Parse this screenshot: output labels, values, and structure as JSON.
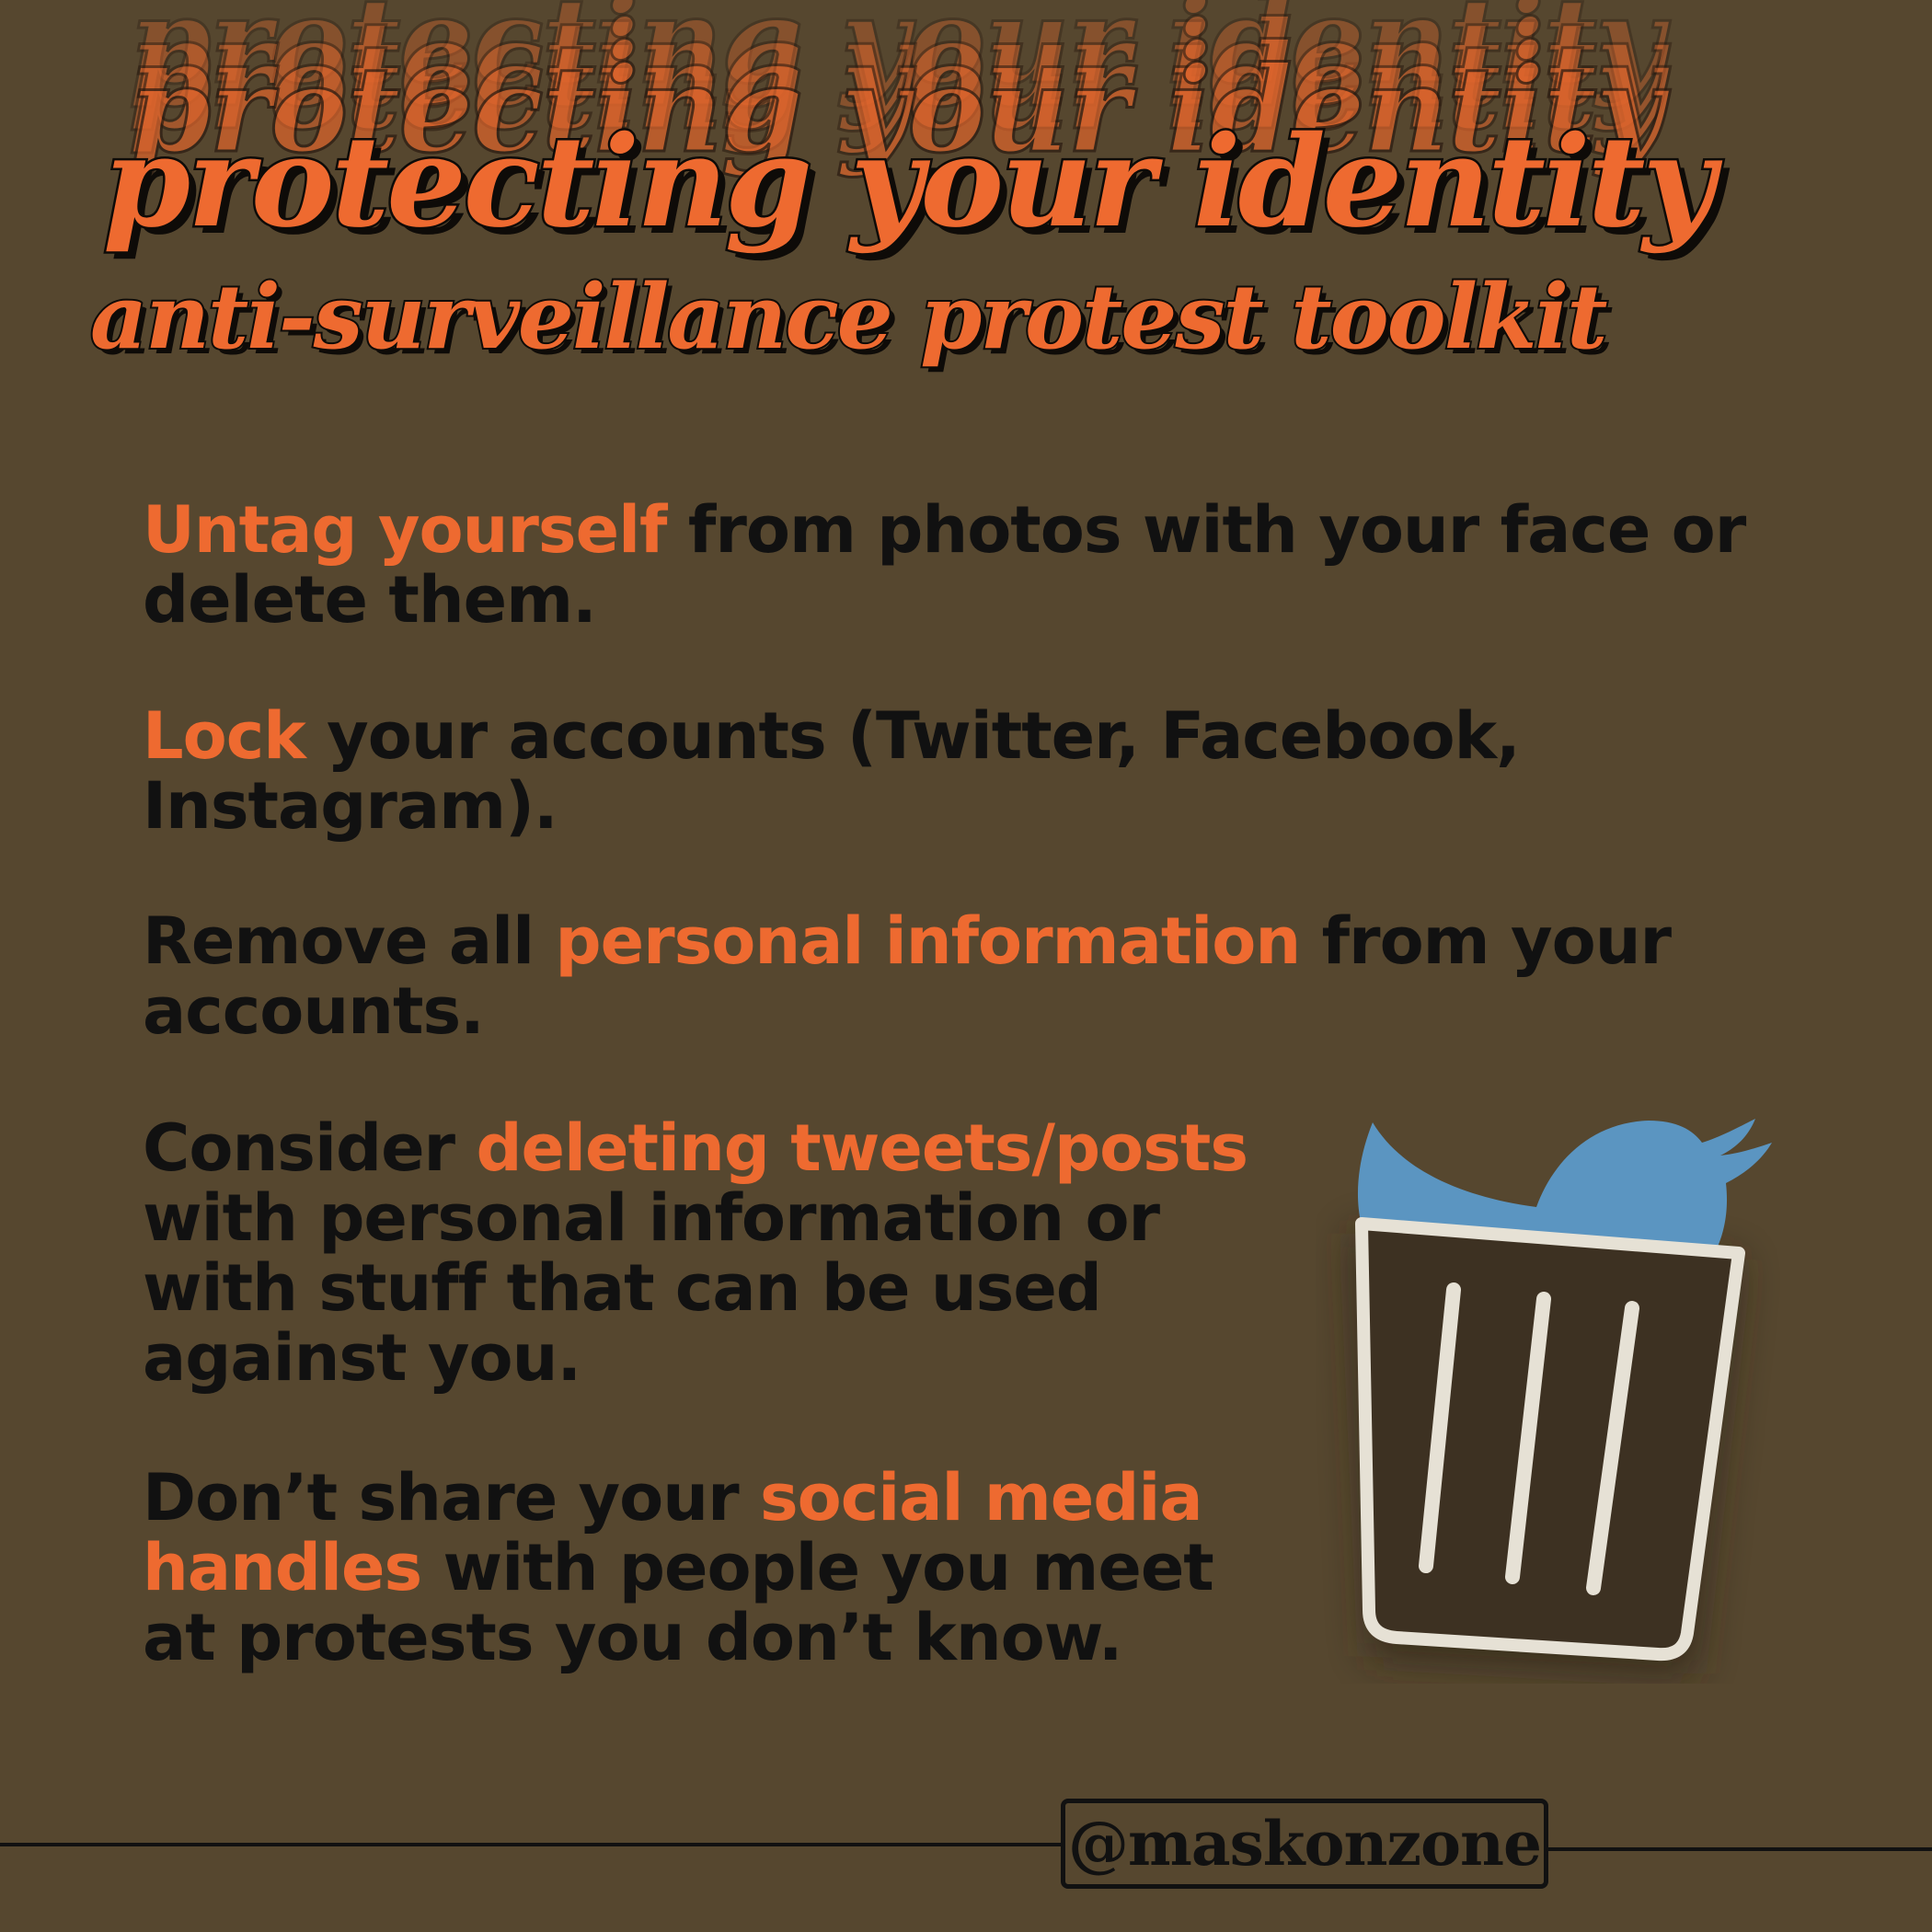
{
  "header": {
    "title": "protecting your identity",
    "subtitle": "anti-surveillance protest toolkit"
  },
  "tips": [
    {
      "pre": "",
      "highlight": "Untag yourself",
      "post": " from photos with your face or delete them."
    },
    {
      "pre": "",
      "highlight": "Lock",
      "post": " your accounts (Twitter, Facebook, Instagram)."
    },
    {
      "pre": "Remove all ",
      "highlight": "personal information",
      "post": " from your accounts."
    },
    {
      "pre": "Consider ",
      "highlight": "deleting tweets/posts",
      "post": " with personal information or with stuff that can be used against you."
    },
    {
      "pre": "Don’t share your ",
      "highlight": "social media handles",
      "post": " with people you meet at protests you don’t know."
    }
  ],
  "illustration": {
    "icon": "bird-in-trash-can-icon",
    "bird_color": "#5b95c1",
    "can_color": "#e6e1d5"
  },
  "footer": {
    "handle": "@maskonzone"
  },
  "colors": {
    "background": "#56472f",
    "accent": "#ee6a30",
    "text": "#111111"
  }
}
